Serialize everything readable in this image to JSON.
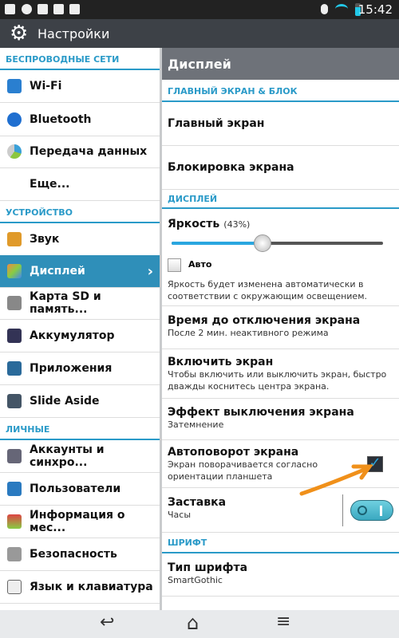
{
  "status_bar": {
    "time": "15:42",
    "icons": [
      "gallery-icon",
      "hangouts-icon",
      "lg-icon",
      "task-icon",
      "play-store-icon",
      "bluetooth-icon",
      "wifi-icon",
      "battery-icon"
    ]
  },
  "action_bar": {
    "title": "Настройки",
    "icon": "gear-icon"
  },
  "sidebar": {
    "sections": [
      {
        "header": "БЕСПРОВОДНЫЕ СЕТИ",
        "items": [
          {
            "label": "Wi-Fi",
            "icon": "wifi-icon"
          },
          {
            "label": "Bluetooth",
            "icon": "bluetooth-icon"
          },
          {
            "label": "Передача данных",
            "icon": "data-usage-icon"
          },
          {
            "label": "Еще...",
            "icon": ""
          }
        ]
      },
      {
        "header": "УСТРОЙСТВО",
        "items": [
          {
            "label": "Звук",
            "icon": "sound-icon"
          },
          {
            "label": "Дисплей",
            "icon": "display-icon",
            "selected": true
          },
          {
            "label": "Карта SD и память...",
            "icon": "storage-icon"
          },
          {
            "label": "Аккумулятор",
            "icon": "battery-icon"
          },
          {
            "label": "Приложения",
            "icon": "apps-icon"
          },
          {
            "label": "Slide Aside",
            "icon": "slide-aside-icon"
          }
        ]
      },
      {
        "header": "ЛИЧНЫЕ",
        "items": [
          {
            "label": "Аккаунты и синхро...",
            "icon": "accounts-icon"
          },
          {
            "label": "Пользователи",
            "icon": "users-icon"
          },
          {
            "label": "Информация о мес...",
            "icon": "location-icon"
          },
          {
            "label": "Безопасность",
            "icon": "lock-icon"
          },
          {
            "label": "Язык и клавиатура",
            "icon": "keyboard-icon"
          }
        ]
      }
    ]
  },
  "detail": {
    "title": "Дисплей",
    "sec1": "ГЛАВНЫЙ ЭКРАН & БЛОК",
    "home_screen": "Главный экран",
    "lock_screen": "Блокировка экрана",
    "sec2": "ДИСПЛЕЙ",
    "brightness": {
      "label": "Яркость",
      "value_text": "(43%)",
      "value": 43,
      "auto_label": "Авто",
      "auto_checked": false,
      "description": "Яркость будет изменена автоматически в соответствии с окружающим освещением."
    },
    "timeout": {
      "title": "Время до отключения экрана",
      "summary": "После 2 мин. неактивного режима"
    },
    "wake": {
      "title": "Включить экран",
      "summary": "Чтобы включить или выключить экран, быстро дважды коснитесь центра экрана."
    },
    "off_effect": {
      "title": "Эффект выключения экрана",
      "summary": "Затемнение"
    },
    "autorotate": {
      "title": "Автоповорот экрана",
      "summary": "Экран поворачивается согласно ориентации планшета",
      "checked": true
    },
    "daydream": {
      "title": "Заставка",
      "summary": "Часы",
      "enabled": true
    },
    "sec3": "ШРИФТ",
    "font_type": {
      "title": "Тип шрифта",
      "summary": "SmartGothic"
    }
  },
  "colors": {
    "accent": "#2a9ac8",
    "selected": "#2f8fb9",
    "annotation_arrow": "#f0901a"
  }
}
